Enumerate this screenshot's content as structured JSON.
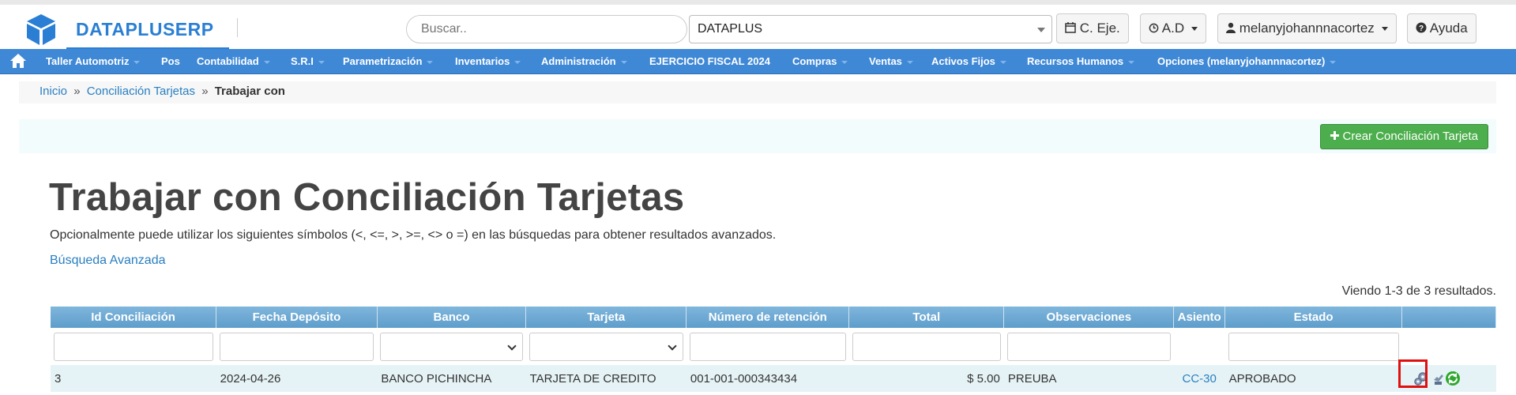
{
  "brand": {
    "name": "DATAPLUSERP",
    "color": "#2a7fd4"
  },
  "search": {
    "placeholder": "Buscar.."
  },
  "company_select": {
    "value": "DATAPLUS"
  },
  "top_buttons": {
    "fiscal_year": "C. Eje.",
    "ad": "A.D",
    "user": "melanyjohannnacortez",
    "help": "Ayuda"
  },
  "nav": {
    "home_icon": "home-icon",
    "items": [
      "Taller Automotriz",
      "Pos",
      "Contabilidad",
      "S.R.I",
      "Parametrización",
      "Inventarios",
      "Administración",
      "EJERCICIO FISCAL 2024",
      "Compras",
      "Ventas",
      "Activos Fijos",
      "Recursos Humanos",
      "Opciones (melanyjohannnacortez)"
    ]
  },
  "breadcrumb": {
    "home": "Inicio",
    "parent": "Conciliación Tarjetas",
    "sep": "»",
    "current": "Trabajar con"
  },
  "create_button": "Crear Conciliación Tarjeta",
  "page_title": "Trabajar con Conciliación Tarjetas",
  "hint": "Opcionalmente puede utilizar los siguientes símbolos (<, <=, >, >=, <> o =) en las búsquedas para obtener resultados avanzados.",
  "advanced_search": "Búsqueda Avanzada",
  "summary": "Viendo 1-3 de 3 resultados.",
  "table": {
    "columns": [
      "Id Conciliación",
      "Fecha Depósito",
      "Banco",
      "Tarjeta",
      "Número de retención",
      "Total",
      "Observaciones",
      "Asiento",
      "Estado",
      ""
    ],
    "rows": [
      {
        "id": "3",
        "fecha": "2024-04-26",
        "banco": "BANCO PICHINCHA",
        "tarjeta": "TARJETA DE CREDITO",
        "retencion": "001-001-000343434",
        "total": "$ 5.00",
        "observaciones": "PREUBA",
        "asiento": "CC-30",
        "estado": "APROBADO"
      }
    ]
  },
  "colors": {
    "navbar": "#3f88d6",
    "header": "#6aa8d3",
    "success": "#4cae4c",
    "link": "#2a7fc0",
    "highlight": "#e01010"
  }
}
